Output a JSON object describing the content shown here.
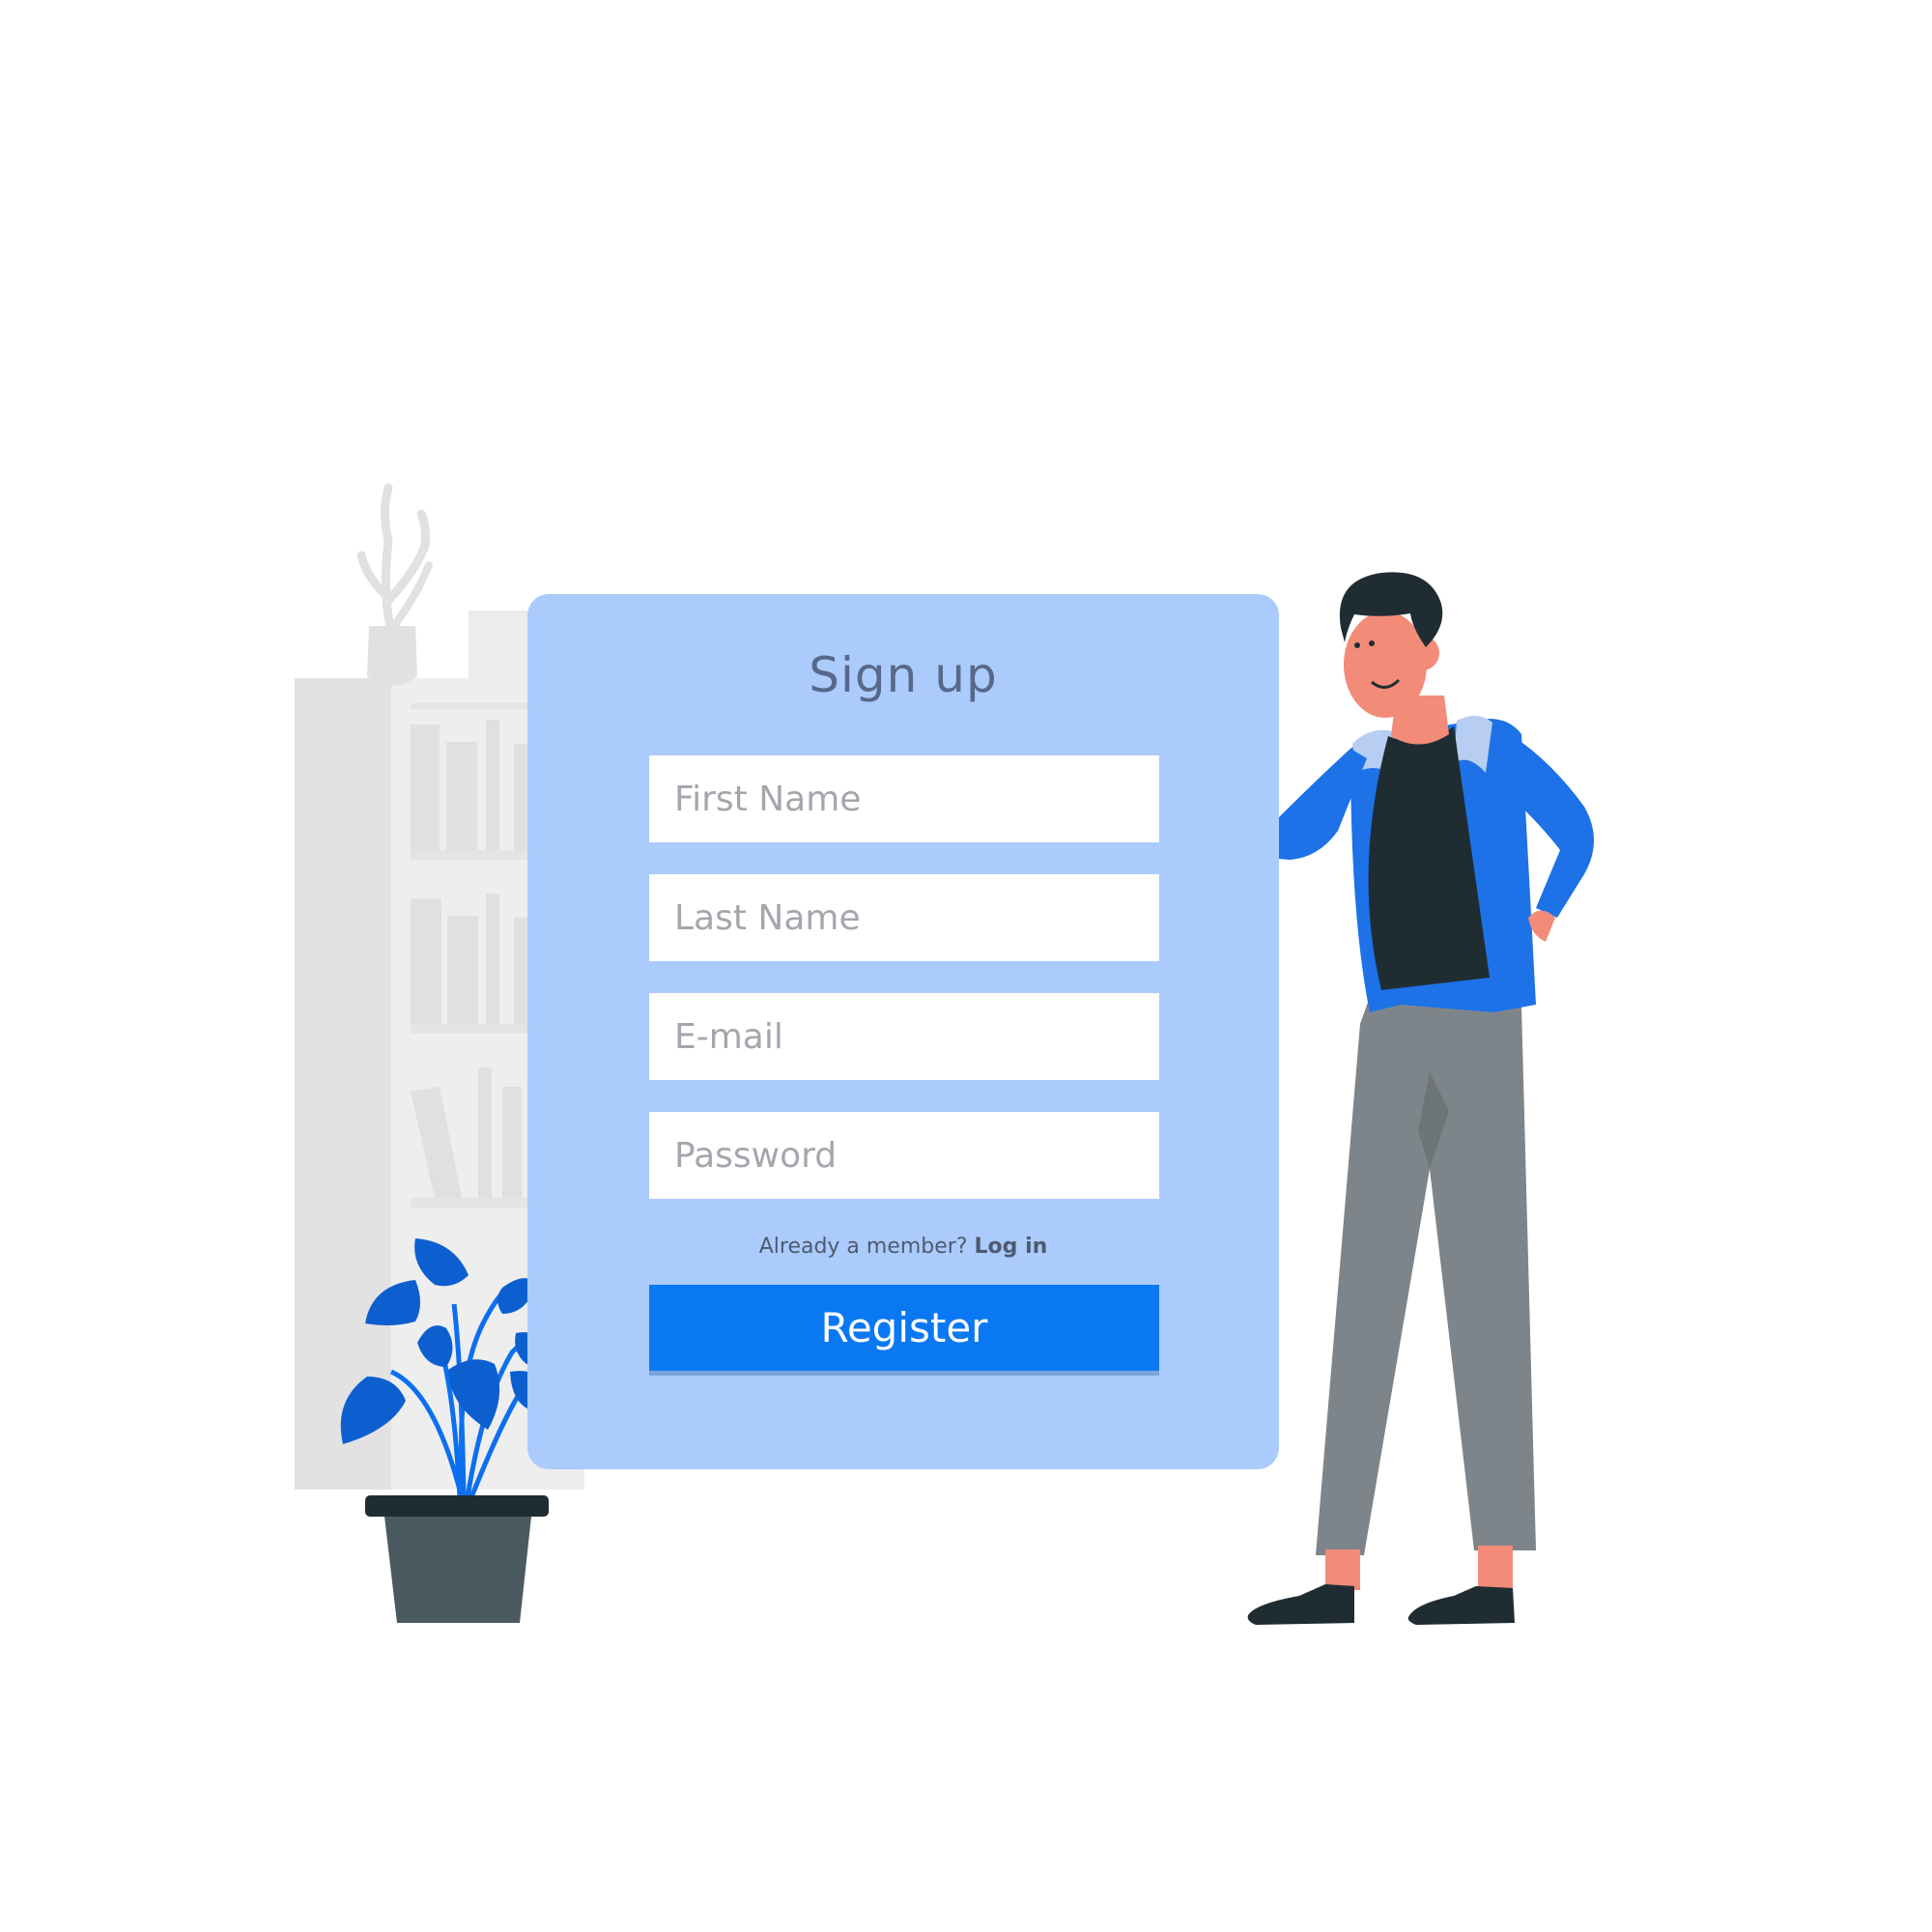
{
  "form": {
    "title": "Sign up",
    "fields": {
      "first_name": {
        "placeholder": "First Name",
        "value": ""
      },
      "last_name": {
        "placeholder": "Last Name",
        "value": ""
      },
      "email": {
        "placeholder": "E-mail",
        "value": ""
      },
      "password": {
        "placeholder": "Password",
        "value": ""
      }
    },
    "login_prompt": "Already a member?",
    "login_link": "Log in",
    "register_label": "Register"
  },
  "colors": {
    "card_background": "#abcbfc",
    "accent": "#0a78f2",
    "title_text": "#57688a",
    "placeholder_text": "#a3a7ad",
    "bookshelf": "#e4e4e4"
  }
}
